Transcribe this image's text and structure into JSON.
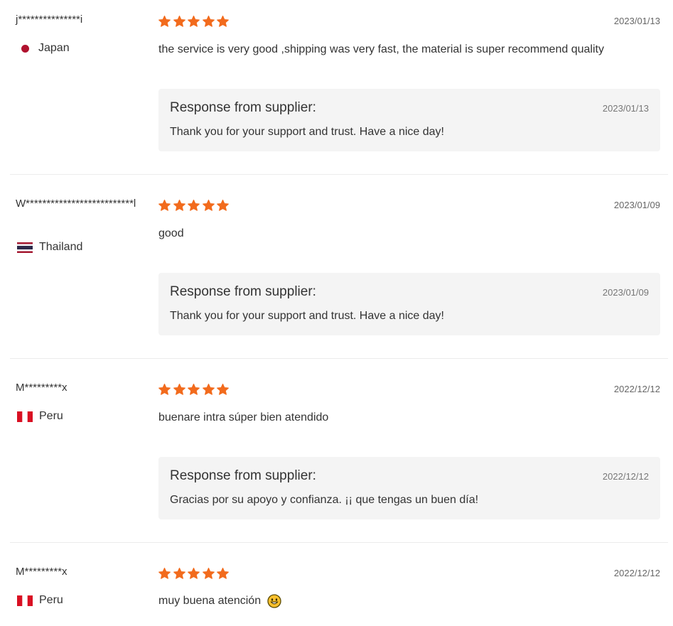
{
  "reviews": [
    {
      "user": "j***************i",
      "country": "Japan",
      "flag": "japan-flag",
      "rating": 5,
      "date": "2023/01/13",
      "text": "the service is very good ,shipping was very fast, the material is super recommend quality",
      "response": {
        "title": "Response from supplier:",
        "date": "2023/01/13",
        "text": "Thank you for your support and trust. Have a nice day!"
      }
    },
    {
      "user": "W**************************l",
      "country": "Thailand",
      "flag": "thailand-flag",
      "rating": 5,
      "date": "2023/01/09",
      "text": "good",
      "response": {
        "title": "Response from supplier:",
        "date": "2023/01/09",
        "text": "Thank you for your support and trust. Have a nice day!"
      }
    },
    {
      "user": "M*********x",
      "country": "Peru",
      "flag": "peru-flag",
      "rating": 5,
      "date": "2022/12/12",
      "text": "buenare intra súper bien atendido",
      "response": {
        "title": "Response from supplier:",
        "date": "2022/12/12",
        "text": "Gracias por su apoyo y confianza. ¡¡ que tengas un buen día!"
      }
    },
    {
      "user": "M*********x",
      "country": "Peru",
      "flag": "peru-flag",
      "rating": 5,
      "date": "2022/12/12",
      "text": "muy buena atención",
      "emoji": "grinning-face-emoji"
    }
  ],
  "colors": {
    "star": "#f26b1d",
    "response_bg": "#f4f4f4",
    "divider": "#ececec"
  }
}
